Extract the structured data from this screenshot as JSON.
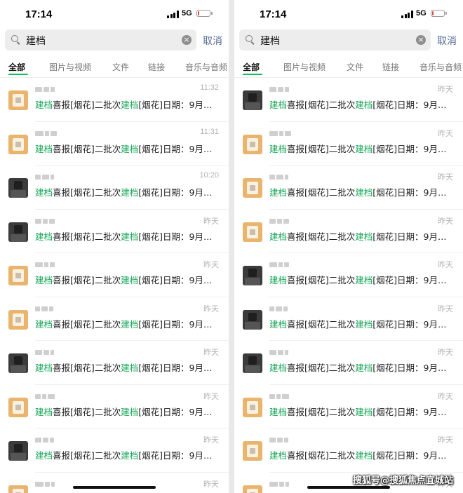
{
  "status": {
    "time": "17:14",
    "network": "5G",
    "battery_percent": 10
  },
  "search": {
    "query": "建档",
    "clear_icon": "clear-icon",
    "cancel_label": "取消"
  },
  "tabs": [
    {
      "label": "全部",
      "active": true
    },
    {
      "label": "图片与视频",
      "active": false
    },
    {
      "label": "文件",
      "active": false
    },
    {
      "label": "链接",
      "active": false
    },
    {
      "label": "音乐与音频",
      "active": false
    }
  ],
  "highlight_color": "#18a558",
  "left": {
    "items": [
      {
        "time": "11:32",
        "avatar": "tan"
      },
      {
        "time": "11:31",
        "avatar": "tan"
      },
      {
        "time": "10:20",
        "avatar": "dark"
      },
      {
        "time": "昨天",
        "avatar": "dark"
      },
      {
        "time": "昨天",
        "avatar": "tan"
      },
      {
        "time": "昨天",
        "avatar": "tan"
      },
      {
        "time": "昨天",
        "avatar": "dark"
      },
      {
        "time": "昨天",
        "avatar": "tan"
      },
      {
        "time": "昨天",
        "avatar": "dark"
      },
      {
        "time": "昨天",
        "avatar": "tan"
      }
    ]
  },
  "right": {
    "items": [
      {
        "time": "昨天",
        "avatar": "dark"
      },
      {
        "time": "昨天",
        "avatar": "tan"
      },
      {
        "time": "昨天",
        "avatar": "tan"
      },
      {
        "time": "昨天",
        "avatar": "tan"
      },
      {
        "time": "昨天",
        "avatar": "dark"
      },
      {
        "time": "昨天",
        "avatar": "dark"
      },
      {
        "time": "昨天",
        "avatar": "dark"
      },
      {
        "time": "昨天",
        "avatar": "tan"
      },
      {
        "time": "昨天",
        "avatar": "tan"
      },
      {
        "time": "昨天",
        "avatar": "tan"
      }
    ]
  },
  "snippet_parts": [
    {
      "text": "建档",
      "hl": true
    },
    {
      "text": "喜报[烟花]二批次",
      "hl": false
    },
    {
      "text": "建档",
      "hl": true
    },
    {
      "text": "[烟花]日期：9月…",
      "hl": false
    }
  ],
  "watermark": "搜狐号@搜狐焦点宜城站"
}
